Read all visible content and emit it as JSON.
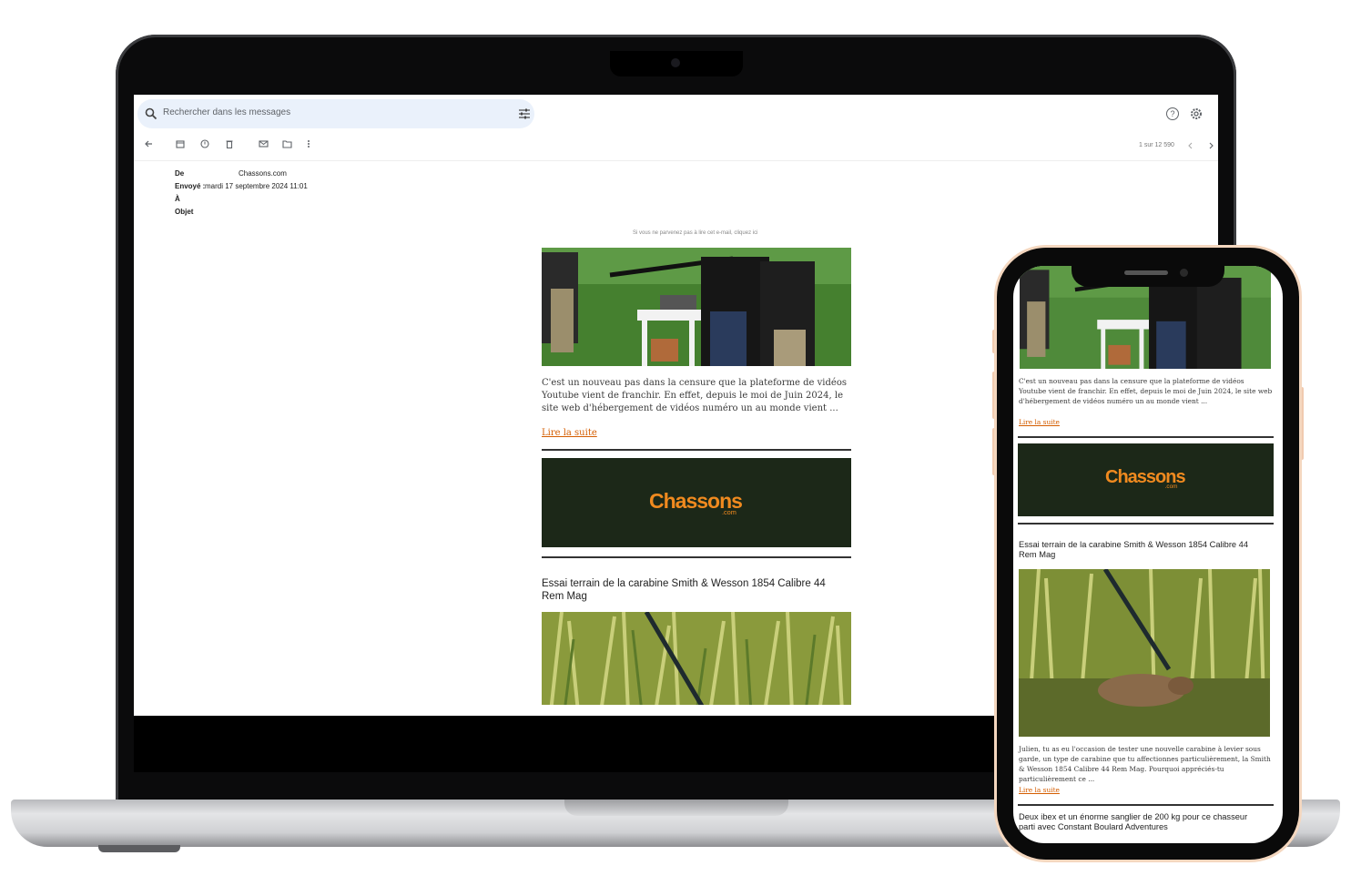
{
  "gmail": {
    "search_placeholder": "Rechercher dans les messages",
    "help_icon": "?",
    "pager": "1 sur 12 590",
    "headers": {
      "from_label": "De",
      "from_value": "Chassons.com",
      "sent_label": "Envoyé :",
      "sent_value": "mardi 17 septembre 2024 11:01",
      "to_label": "À",
      "subject_label": "Objet"
    }
  },
  "email": {
    "view_online_note": "Si vous ne parvenez pas à lire cet e-mail, cliquez ici",
    "article1_text": "C'est un nouveau pas dans la censure que la plateforme de vidéos Youtube vient de franchir. En effet, depuis le moi de Juin 2024, le site web d'hébergement de vidéos numéro un au monde vient ...",
    "read_more": "Lire la suite",
    "logo_text": "Chassons",
    "logo_suffix": ".com",
    "article2_title": "Essai terrain de la carabine Smith & Wesson 1854 Calibre 44 Rem Mag",
    "article2_text": "Julien, tu as eu l'occasion de tester une nouvelle carabine à levier sous garde, un type de carabine que tu affectionnes particulièrement, la Smith & Wesson 1854 Calibre 44 Rem Mag. Pourquoi appréciés-tu particulièrement ce ...",
    "article3_title": "Deux ibex et un énorme sanglier de 200 kg pour ce chasseur parti avec Constant Boulard Adventures"
  },
  "colors": {
    "brand_orange": "#f08a1f",
    "banner_green": "#1c2818",
    "link_orange": "#d45d00"
  }
}
